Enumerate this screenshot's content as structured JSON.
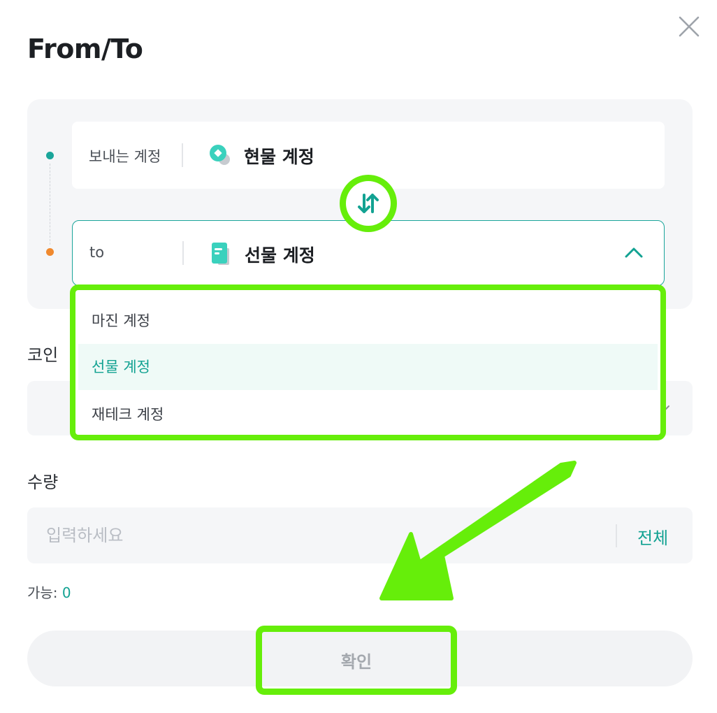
{
  "dialog": {
    "title": "From/To"
  },
  "from": {
    "label": "보내는 계정",
    "account": "현물 계정",
    "icon": "spot-wallet-icon",
    "dot_color": "#1aa59a"
  },
  "to": {
    "label": "to",
    "account": "선물 계정",
    "icon": "futures-book-icon",
    "dot_color": "#f0892e",
    "expanded": true
  },
  "dropdown": {
    "options": [
      {
        "label": "마진 계정",
        "selected": false
      },
      {
        "label": "선물 계정",
        "selected": true
      },
      {
        "label": "재테크 계정",
        "selected": false
      }
    ]
  },
  "coin": {
    "label": "코인"
  },
  "quantity": {
    "label": "수량",
    "placeholder": "입력하세요",
    "max_label": "전체"
  },
  "available": {
    "label": "가능:",
    "value": "0"
  },
  "confirm": {
    "label": "확인"
  },
  "colors": {
    "accent": "#12a292",
    "highlight": "#66ee0a",
    "card_bg": "#f5f6f8"
  }
}
